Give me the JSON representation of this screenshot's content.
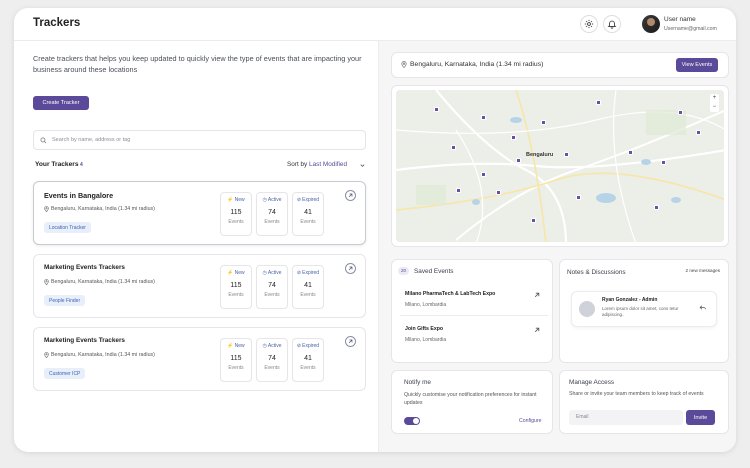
{
  "header": {
    "title": "Trackers",
    "user_name": "User name",
    "user_email": "Username@gmail.com",
    "icons": [
      "gear-icon",
      "bell-icon"
    ]
  },
  "intro": "Create trackers that helps you keep updated to quickly view the type of events that are impacting your business around these locations",
  "create_button": "Create Tracker",
  "search": {
    "placeholder": "Search by name, address or tag"
  },
  "trackers_header": {
    "title": "Your Trackers",
    "count": "4",
    "sort_label": "Sort by",
    "sort_value": "Last Modified"
  },
  "trackers": [
    {
      "name": "Events in Bangalore",
      "location": "Bengaluru, Karnataka, India (1.34 mi radius)",
      "tag": "Location Tracker",
      "stats": [
        {
          "label": "New",
          "value": "115",
          "unit": "Events"
        },
        {
          "label": "Active",
          "value": "74",
          "unit": "Events"
        },
        {
          "label": "Expired",
          "value": "41",
          "unit": "Events"
        }
      ]
    },
    {
      "name": "Marketing Events Trackers",
      "location": "Bengaluru, Karnataka, India (1.34 mi radius)",
      "tag": "People Finder",
      "stats": [
        {
          "label": "New",
          "value": "115",
          "unit": "Events"
        },
        {
          "label": "Active",
          "value": "74",
          "unit": "Events"
        },
        {
          "label": "Expired",
          "value": "41",
          "unit": "Events"
        }
      ]
    },
    {
      "name": "Marketing Events Trackers",
      "location": "Bengaluru, Karnataka, India (1.34 mi radius)",
      "tag": "Customer ICP",
      "stats": [
        {
          "label": "New",
          "value": "115",
          "unit": "Events"
        },
        {
          "label": "Active",
          "value": "74",
          "unit": "Events"
        },
        {
          "label": "Expired",
          "value": "41",
          "unit": "Events"
        }
      ]
    }
  ],
  "location_bar": {
    "text": "Bengaluru, Karnataka, India (1.34 mi radius)",
    "button": "View Events"
  },
  "map": {
    "city_label": "Bengaluru",
    "zoom_in": "+",
    "zoom_out": "−"
  },
  "saved_events": {
    "count": "20",
    "title": "Saved Events",
    "items": [
      {
        "title": "Milano PharmaTech & LabTech Expo",
        "subtitle": "Milano, Lombardia"
      },
      {
        "title": "Join Gifts Expo",
        "subtitle": "Milano, Lombardia"
      }
    ]
  },
  "notes": {
    "title": "Notes & Discussions",
    "new_messages": "2 new messages",
    "message": {
      "name": "Ryan Gonzalez - Admin",
      "body": "Lorem ipsum dolor sit amet, cons tetur adipiscing.."
    }
  },
  "notify": {
    "title": "Notify me",
    "description": "Quickly customise your notification preferences for instant updates",
    "toggle_on": true,
    "configure": "Configure"
  },
  "access": {
    "title": "Manage Access",
    "description": "Share or invite your team members to keep track of events",
    "email_placeholder": "Email",
    "invite": "Invite"
  },
  "colors": {
    "accent": "#5b4a99",
    "tag_bg": "#e8effb",
    "tag_text": "#3b63b3"
  }
}
